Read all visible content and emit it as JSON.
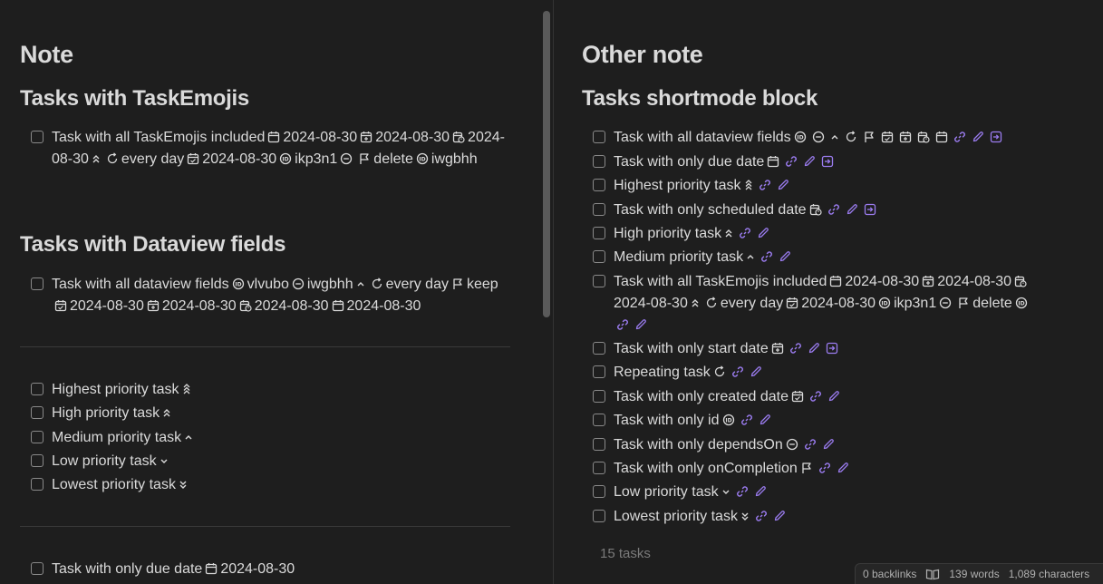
{
  "left": {
    "title": "Note",
    "section1": {
      "heading": "Tasks with TaskEmojis",
      "task": {
        "t1": "Task with all TaskEmojis included",
        "d1": "2024-08-30",
        "d2": "2024-08-30",
        "d3": "2024-08-30",
        "every": "every day",
        "d4": "2024-08-30",
        "id": "ikp3n1",
        "oncompletion": "delete",
        "depends": "iwgbhh"
      }
    },
    "section2": {
      "heading": "Tasks with Dataview fields",
      "task": {
        "t1": "Task with all dataview fields",
        "id": "vlvubo",
        "depends": "iwgbhh",
        "every": "every day",
        "oncompletion": "keep",
        "d1": "2024-08-30",
        "d2": "2024-08-30",
        "d3": "2024-08-30",
        "d4": "2024-08-30"
      }
    },
    "priority_tasks": [
      "Highest priority task",
      "High priority task",
      "Medium priority task",
      "Low priority task",
      "Lowest priority task"
    ],
    "due_task": {
      "label": "Task with only due date",
      "date": "2024-08-30"
    }
  },
  "right": {
    "title": "Other note",
    "heading": "Tasks shortmode block",
    "tasks": [
      "Task with all dataview fields",
      "Task with only due date",
      "Highest priority task",
      "Task with only scheduled date",
      "High priority task",
      "Medium priority task",
      "Task with all TaskEmojis included",
      "Task with only start date",
      "Repeating task",
      "Task with only created date",
      "Task with only id",
      "Task with only dependsOn",
      "Task with only onCompletion",
      "Low priority task",
      "Lowest priority task"
    ],
    "emoji_task": {
      "d1": "2024-08-30",
      "d2": "2024-08-30",
      "d3": "2024-08-30",
      "every": "every day",
      "d4": "2024-08-30",
      "id": "ikp3n1",
      "oncompletion": "delete"
    },
    "count": "15 tasks"
  },
  "status": {
    "backlinks": "0 backlinks",
    "words": "139 words",
    "characters": "1,089 characters"
  },
  "colors": {
    "link_icon": "#9b7cf0",
    "bg": "#1e1e1e",
    "text": "#dadada"
  }
}
